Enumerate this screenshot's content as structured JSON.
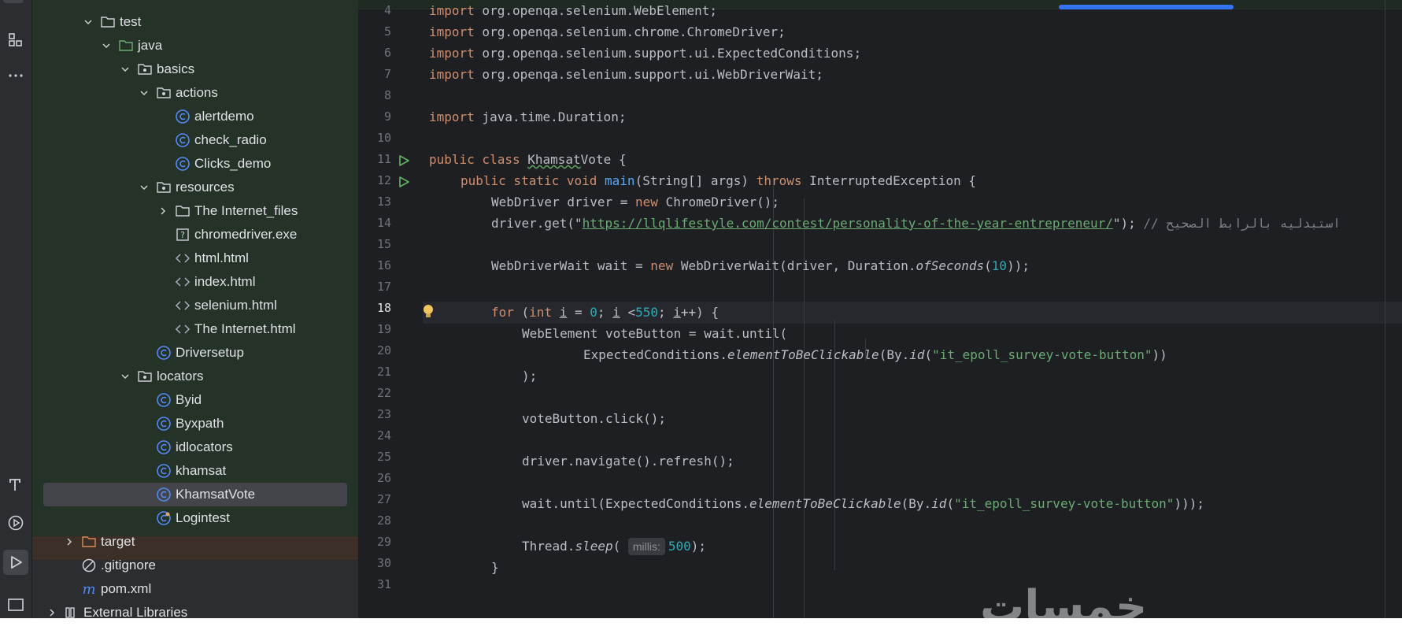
{
  "tree": {
    "items": [
      {
        "label": "test"
      },
      {
        "label": "java"
      },
      {
        "label": "basics"
      },
      {
        "label": "actions"
      },
      {
        "label": "alertdemo"
      },
      {
        "label": "check_radio"
      },
      {
        "label": "Clicks_demo"
      },
      {
        "label": "resources"
      },
      {
        "label": "The Internet_files"
      },
      {
        "label": "chromedriver.exe"
      },
      {
        "label": "html.html"
      },
      {
        "label": "index.html"
      },
      {
        "label": "selenium.html"
      },
      {
        "label": "The Internet.html"
      },
      {
        "label": "Driversetup"
      },
      {
        "label": "locators"
      },
      {
        "label": "Byid"
      },
      {
        "label": "Byxpath"
      },
      {
        "label": "idlocators"
      },
      {
        "label": "khamsat"
      },
      {
        "label": "KhamsatVote"
      },
      {
        "label": "Logintest"
      },
      {
        "label": "target"
      },
      {
        "label": ".gitignore"
      },
      {
        "label": "pom.xml"
      },
      {
        "label": "External Libraries"
      }
    ]
  },
  "editor": {
    "line_numbers": [
      "4",
      "5",
      "6",
      "7",
      "8",
      "9",
      "10",
      "11",
      "12",
      "13",
      "14",
      "15",
      "16",
      "17",
      "18",
      "19",
      "20",
      "21",
      "22",
      "23",
      "24",
      "25",
      "26",
      "27",
      "28",
      "29",
      "30",
      "31"
    ],
    "current_line": "18",
    "code": {
      "l4": {
        "kw": "import",
        "rest": " org.openqa.selenium.WebElement;"
      },
      "l5": {
        "kw": "import",
        "rest": " org.openqa.selenium.chrome.ChromeDriver;"
      },
      "l6": {
        "kw": "import",
        "rest": " org.openqa.selenium.support.ui.ExpectedConditions;"
      },
      "l7": {
        "kw": "import",
        "rest": " org.openqa.selenium.support.ui.WebDriverWait;"
      },
      "l9": {
        "kw": "import",
        "rest": " java.time.Duration;"
      },
      "l11": {
        "kw": "public class",
        "name": "Khamsat",
        "name2": "Vote",
        "rest": " {"
      },
      "l12": {
        "kw": "public static void",
        "fn": "main",
        "mid": "(String[] args) ",
        "kw2": "throws",
        "rest": " InterruptedException {"
      },
      "l13": {
        "a": "WebDriver driver = ",
        "kw": "new",
        "b": " ChromeDriver();"
      },
      "l14": {
        "a": "driver.get(\"",
        "url": "https://llqlifestyle.com/contest/personality-of-the-year-entrepreneur/",
        "b": "\"); ",
        "comment": "// استبدليه بالرابط الصحيح"
      },
      "l16": {
        "a": "WebDriverWait wait = ",
        "kw": "new",
        "b": " WebDriverWait(driver, Duration.",
        "it": "ofSeconds",
        "c": "(",
        "num": "10",
        "d": "));"
      },
      "l18": {
        "kw": "for",
        "a": " (",
        "kw2": "int",
        "sp": " ",
        "v1": "i",
        "b": " = ",
        "n1": "0",
        "c": "; ",
        "v2": "i",
        "d": " <",
        "n2": "550",
        "e": "; ",
        "v3": "i",
        "f": "++) {"
      },
      "l19": {
        "a": "WebElement voteButton = wait.until("
      },
      "l20": {
        "a": "ExpectedConditions.",
        "it": "elementToBeClickable",
        "b": "(By.",
        "it2": "id",
        "c": "(",
        "str": "\"it_epoll_survey-vote-button\"",
        "d": "))"
      },
      "l21": {
        "a": ");"
      },
      "l23": {
        "a": "voteButton.click();"
      },
      "l25": {
        "a": "driver.navigate().refresh();"
      },
      "l27": {
        "a": "wait.until(ExpectedConditions.",
        "it": "elementToBeClickable",
        "b": "(By.",
        "it2": "id",
        "c": "(",
        "str": "\"it_epoll_survey-vote-button\"",
        "d": ")));"
      },
      "l29": {
        "a": "Thread.",
        "it": "sleep",
        "b": "( ",
        "hint": "millis:",
        "num": "500",
        "c": ");"
      },
      "l30": {
        "a": "}"
      }
    },
    "watermark": "خمسات"
  },
  "icons": {
    "toolstrip": [
      "structure-icon",
      "more-icon",
      "tests-icon",
      "services-icon",
      "run-icon",
      "terminal-icon"
    ]
  },
  "colors": {
    "accent": "#3574f0",
    "keyword": "#cf8e6d",
    "string": "#6aab73",
    "number": "#2aacb8",
    "function": "#56a8f5"
  }
}
